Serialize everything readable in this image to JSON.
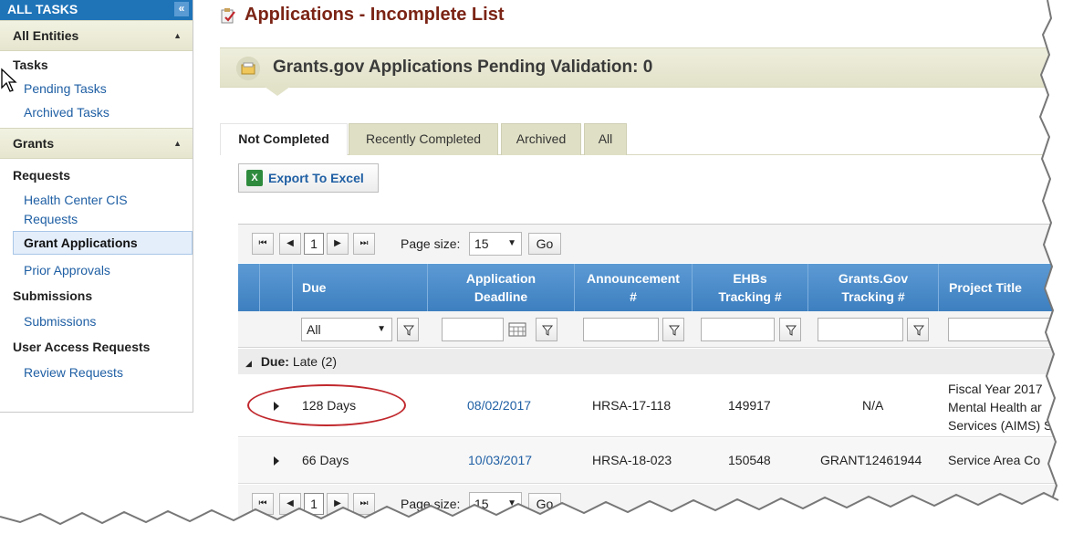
{
  "sidebar": {
    "header": "ALL TASKS",
    "collapse_icon": "«",
    "sections": [
      {
        "label": "All Entities"
      },
      {
        "label": "Grants"
      }
    ],
    "tasks_group": "Tasks",
    "tasks_links": [
      "Pending Tasks",
      "Archived Tasks"
    ],
    "requests_group": "Requests",
    "health_center_line1": "Health Center CIS",
    "health_center_line2": "Requests",
    "grant_applications": "Grant Applications",
    "prior_approvals": "Prior Approvals",
    "submissions_group": "Submissions",
    "submissions_link": "Submissions",
    "user_access_group": "User Access Requests",
    "review_requests": "Review Requests"
  },
  "page": {
    "title": "Applications - Incomplete List",
    "banner": "Grants.gov Applications Pending Validation: 0"
  },
  "tabs": [
    "Not Completed",
    "Recently Completed",
    "Archived",
    "All"
  ],
  "export_label": "Export To Excel",
  "pager": {
    "page": "1",
    "page_size_label": "Page size:",
    "page_size": "15",
    "go": "Go"
  },
  "columns": {
    "due": "Due",
    "app_deadline_1": "Application",
    "app_deadline_2": "Deadline",
    "announcement_1": "Announcement",
    "announcement_2": "#",
    "ehbs_1": "EHBs",
    "ehbs_2": "Tracking #",
    "grantsgov_1": "Grants.Gov",
    "grantsgov_2": "Tracking #",
    "project_title": "Project Title"
  },
  "filter": {
    "due_value": "All"
  },
  "group": {
    "label": "Due:",
    "value": "Late (2)"
  },
  "rows": [
    {
      "due": "128 Days",
      "deadline": "08/02/2017",
      "announcement": "HRSA-17-118",
      "ehbs": "149917",
      "grantsgov": "N/A",
      "title_1": "Fiscal Year 2017",
      "title_2": "Mental Health ar",
      "title_3": "Services (AIMS) S"
    },
    {
      "due": "66 Days",
      "deadline": "10/03/2017",
      "announcement": "HRSA-18-023",
      "ehbs": "150548",
      "grantsgov": "GRANT12461944",
      "title_1": "Service Area Co"
    }
  ]
}
